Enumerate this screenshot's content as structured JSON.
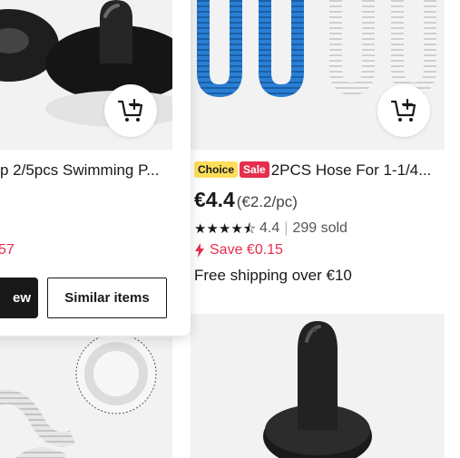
{
  "left_product": {
    "title": "p 2/5pcs Swimming P...",
    "price_fragment": "57",
    "view_label": "ew",
    "similar_label": "Similar items"
  },
  "right_product": {
    "badge_choice": "Choice",
    "badge_sale": "Sale",
    "title": "2PCS Hose For 1-1/4...",
    "price": "€4.4",
    "unit_price": "(€2.2/pc)",
    "rating": "4.4",
    "rating_stars": 4.5,
    "sold": "299 sold",
    "save": "Save €0.15",
    "shipping": "Free shipping over €10"
  },
  "icons": {
    "cart": "add-to-cart-icon",
    "save": "price-drop-icon",
    "star": "star-icon"
  },
  "colors": {
    "accent_red": "#e62e4d",
    "choice_yellow": "#fddf5a",
    "text_dark": "#191919",
    "image_bg": "#f2f2f2"
  }
}
